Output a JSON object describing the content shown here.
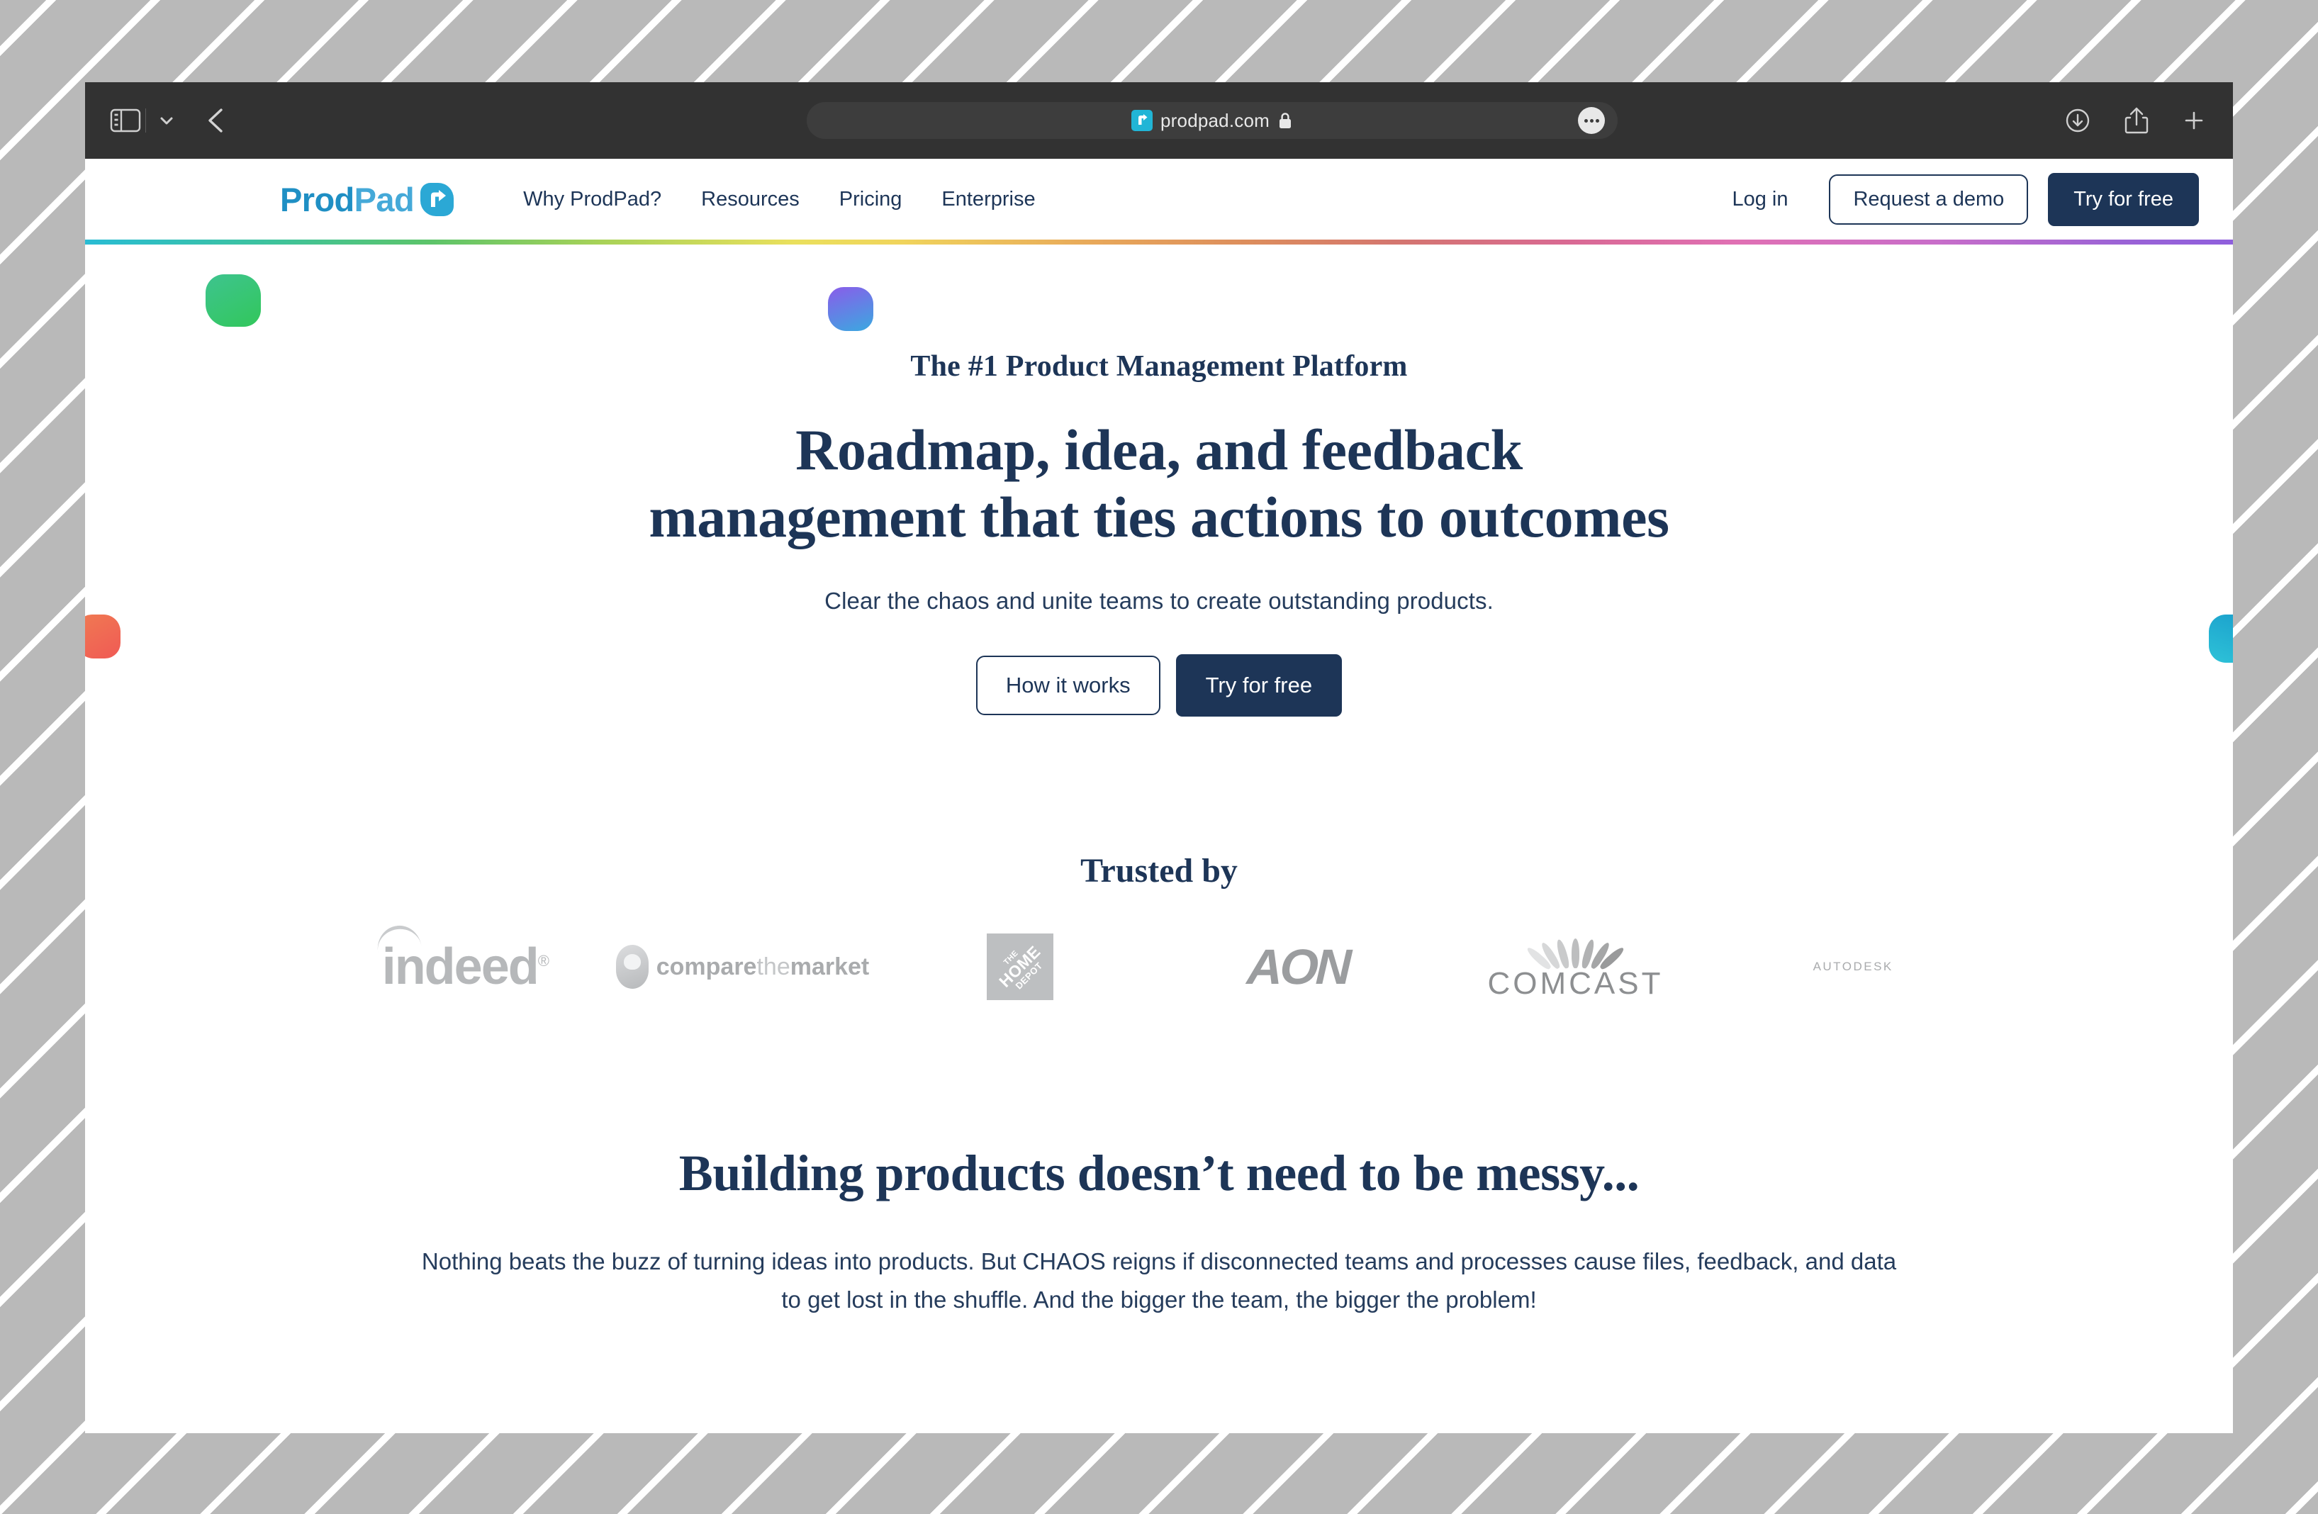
{
  "browser": {
    "toolbar": {
      "sidebar_toggle_name": "sidebar-toggle-icon",
      "tab_overview_name": "chevron-down-icon",
      "back_name": "back-arrow-icon",
      "url": "prodpad.com",
      "lock_name": "lock-icon",
      "more_name": "more-options-icon",
      "download_name": "download-icon",
      "share_name": "share-icon",
      "new_tab_name": "new-tab-plus-icon",
      "favicon_name": "prodpad-favicon",
      "favicon_color": "#21b5d6",
      "chrome_bg": "#323232"
    }
  },
  "site": {
    "logo": {
      "part1": "Prod",
      "part2": "Pad",
      "mark_name": "prodpad-logo-mark"
    },
    "nav": [
      {
        "label": "Why ProdPad?",
        "name": "nav-why-prodpad"
      },
      {
        "label": "Resources",
        "name": "nav-resources"
      },
      {
        "label": "Pricing",
        "name": "nav-pricing"
      },
      {
        "label": "Enterprise",
        "name": "nav-enterprise"
      }
    ],
    "header_actions": {
      "login": "Log in",
      "request_demo": "Request a demo",
      "try_free": "Try for free"
    },
    "colors": {
      "navy": "#1d3557",
      "logo_blue_dark": "#1f8fc4",
      "logo_blue_light": "#45a9d8",
      "gradient_rule": "cyan-green-yellow-orange-pink-purple"
    }
  },
  "hero": {
    "eyebrow": "The #1 Product Management Platform",
    "title_line1": "Roadmap, idea, and feedback",
    "title_line2": "management that ties actions to outcomes",
    "subtitle": "Clear the chaos and unite teams to create outstanding products.",
    "cta_secondary": "How it works",
    "cta_primary": "Try for free",
    "decorations": [
      {
        "name": "blob-green",
        "color": "#32c75b"
      },
      {
        "name": "blob-purple",
        "color": "#8a5cea"
      },
      {
        "name": "blob-orange",
        "color": "#f05a55"
      },
      {
        "name": "blob-teal",
        "color": "#2ec2d8"
      }
    ]
  },
  "trusted": {
    "heading": "Trusted by",
    "logos": [
      {
        "name": "logo-indeed",
        "label": "indeed",
        "mark": "®"
      },
      {
        "name": "logo-comparethemarket",
        "label_bold_1": "compare",
        "label_light": "the",
        "label_bold_2": "market"
      },
      {
        "name": "logo-home-depot",
        "line1": "THE",
        "line2": "HOME",
        "line3": "DEPOT"
      },
      {
        "name": "logo-aon",
        "label": "AON"
      },
      {
        "name": "logo-comcast",
        "label": "COMCAST"
      },
      {
        "name": "logo-autodesk",
        "label": "AUTODESK"
      }
    ]
  },
  "messy": {
    "heading": "Building products doesn’t need to be messy...",
    "paragraph": "Nothing beats the buzz of turning ideas into products. But CHAOS reigns if disconnected teams and processes cause files, feedback, and data to get lost in the shuffle. And the bigger the team, the bigger the problem!"
  }
}
